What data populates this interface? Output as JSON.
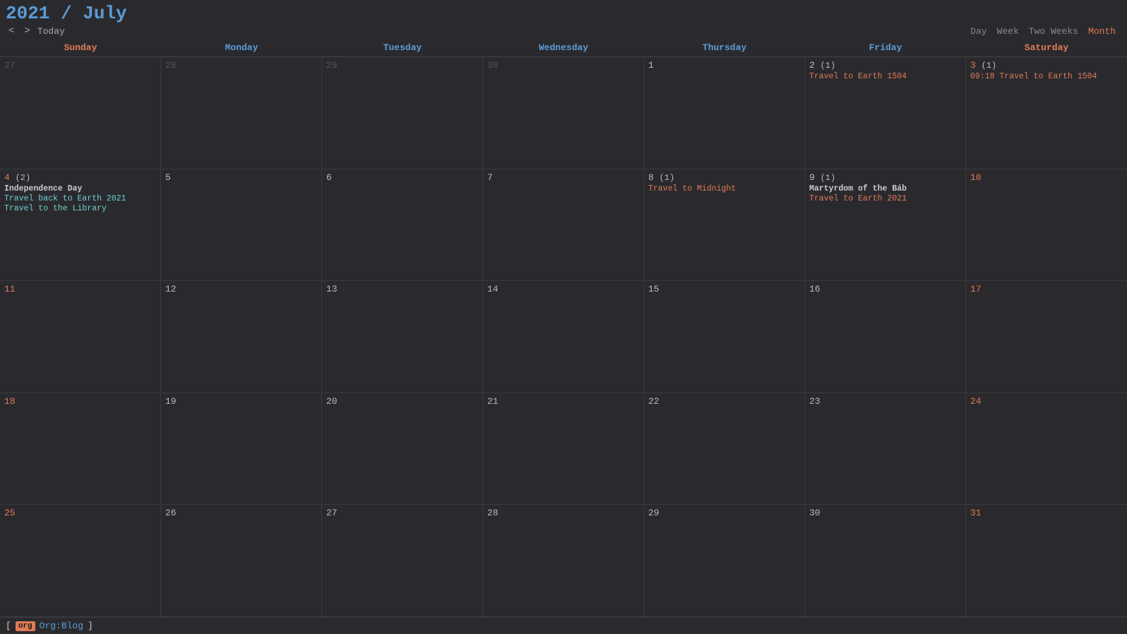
{
  "header": {
    "title": "2021 / July",
    "year": "2021",
    "slash": " / ",
    "month": "July",
    "nav": {
      "prev": "<",
      "next": ">",
      "today": "Today"
    },
    "views": [
      "Day",
      "Week",
      "Two Weeks",
      "Month"
    ],
    "active_view": "Month"
  },
  "day_headers": [
    {
      "label": "Sunday",
      "type": "weekend"
    },
    {
      "label": "Monday",
      "type": "weekday"
    },
    {
      "label": "Tuesday",
      "type": "weekday"
    },
    {
      "label": "Wednesday",
      "type": "weekday"
    },
    {
      "label": "Thursday",
      "type": "weekday"
    },
    {
      "label": "Friday",
      "type": "weekday"
    },
    {
      "label": "Saturday",
      "type": "weekend"
    }
  ],
  "weeks": [
    [
      {
        "day": "27",
        "other_month": true,
        "col": "sun"
      },
      {
        "day": "28",
        "other_month": true,
        "col": "mon"
      },
      {
        "day": "29",
        "other_month": true,
        "col": "tue"
      },
      {
        "day": "30",
        "other_month": true,
        "col": "wed"
      },
      {
        "day": "1",
        "col": "thu"
      },
      {
        "day": "2",
        "col": "fri",
        "badge": "(1)",
        "events": [
          {
            "text": "Travel to Earth 1504",
            "style": "orange"
          }
        ]
      },
      {
        "day": "3",
        "col": "sat",
        "badge": "(1)",
        "events": [
          {
            "text": "09:18 Travel to Earth 1504",
            "style": "orange"
          }
        ]
      }
    ],
    [
      {
        "day": "4",
        "col": "sun",
        "badge": "(2)",
        "events": [
          {
            "text": "Independence Day",
            "style": "bold"
          },
          {
            "text": "Travel back to Earth 2021",
            "style": "cyan"
          },
          {
            "text": "Travel to the Library",
            "style": "cyan"
          }
        ]
      },
      {
        "day": "5",
        "col": "mon"
      },
      {
        "day": "6",
        "col": "tue"
      },
      {
        "day": "7",
        "col": "wed"
      },
      {
        "day": "8",
        "col": "thu",
        "badge": "(1)",
        "events": [
          {
            "text": "Travel to Midnight",
            "style": "orange"
          }
        ]
      },
      {
        "day": "9",
        "col": "fri",
        "badge": "(1)",
        "events": [
          {
            "text": "Martyrdom of the Báb",
            "style": "bold"
          },
          {
            "text": "Travel to Earth 2021",
            "style": "orange"
          }
        ]
      },
      {
        "day": "10",
        "col": "sat"
      }
    ],
    [
      {
        "day": "11",
        "col": "sun"
      },
      {
        "day": "12",
        "col": "mon"
      },
      {
        "day": "13",
        "col": "tue"
      },
      {
        "day": "14",
        "col": "wed"
      },
      {
        "day": "15",
        "col": "thu"
      },
      {
        "day": "16",
        "col": "fri"
      },
      {
        "day": "17",
        "col": "sat"
      }
    ],
    [
      {
        "day": "18",
        "col": "sun"
      },
      {
        "day": "19",
        "col": "mon"
      },
      {
        "day": "20",
        "col": "tue"
      },
      {
        "day": "21",
        "col": "wed"
      },
      {
        "day": "22",
        "col": "thu"
      },
      {
        "day": "23",
        "col": "fri"
      },
      {
        "day": "24",
        "col": "sat"
      }
    ],
    [
      {
        "day": "25",
        "col": "sun"
      },
      {
        "day": "26",
        "col": "mon"
      },
      {
        "day": "27",
        "col": "tue"
      },
      {
        "day": "28",
        "col": "wed"
      },
      {
        "day": "29",
        "col": "thu"
      },
      {
        "day": "30",
        "col": "fri",
        "today": true
      },
      {
        "day": "31",
        "col": "sat"
      }
    ]
  ],
  "bottom_bar": {
    "tag": "org",
    "label": "Org:Blog"
  }
}
